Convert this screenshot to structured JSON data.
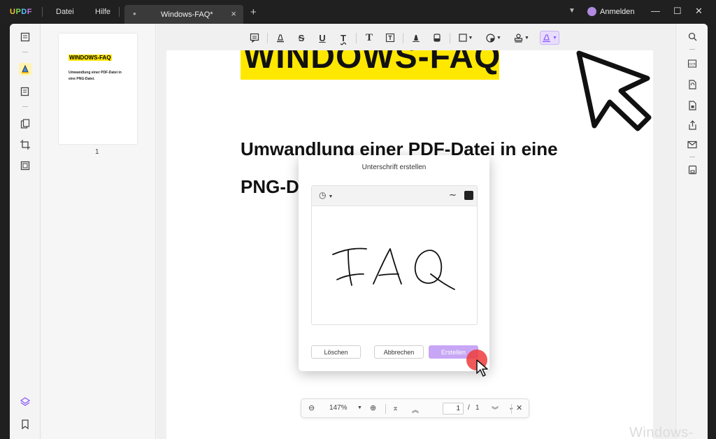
{
  "titlebar": {
    "app_logo": "UPDF",
    "menu": [
      "Datei",
      "Hilfe"
    ],
    "tab_title": "Windows-FAQ*",
    "signin": "Anmelden",
    "icons": [
      "chevron-down-icon",
      "avatar-icon",
      "minimize-icon",
      "maximize-icon",
      "close-icon"
    ]
  },
  "thumbnail": {
    "title": "WINDOWS-FAQ",
    "text": "Umwandlung einer PDF-Datei in eine PNG-Datei.",
    "page_number": "1"
  },
  "document": {
    "heading": "WINDOWS-FAQ",
    "subheading_line1": "Umwandlung einer PDF-Datei in eine",
    "subheading_line2": "PNG-D"
  },
  "toolbar": {
    "tools": [
      "comment",
      "highlight",
      "strikethrough",
      "underline",
      "squiggly",
      "text",
      "textbox",
      "pencil",
      "eraser",
      "shape",
      "sticker",
      "stamp",
      "signature"
    ],
    "active_tool": "signature"
  },
  "dialog": {
    "title": "Unterschrift erstellen",
    "signature_text": "FAQ",
    "stroke_color": "#222222",
    "buttons": {
      "clear": "Löschen",
      "cancel": "Abbrechen",
      "create": "Erstellen"
    }
  },
  "navbar": {
    "zoom": "147%",
    "current_page": "1",
    "page_separator": "/",
    "total_pages": "1"
  },
  "watermark": "Windows-FAQ",
  "colors": {
    "accent": "#8a5cf6",
    "highlight": "#ffe800",
    "primary_button": "#c7a6f5"
  }
}
